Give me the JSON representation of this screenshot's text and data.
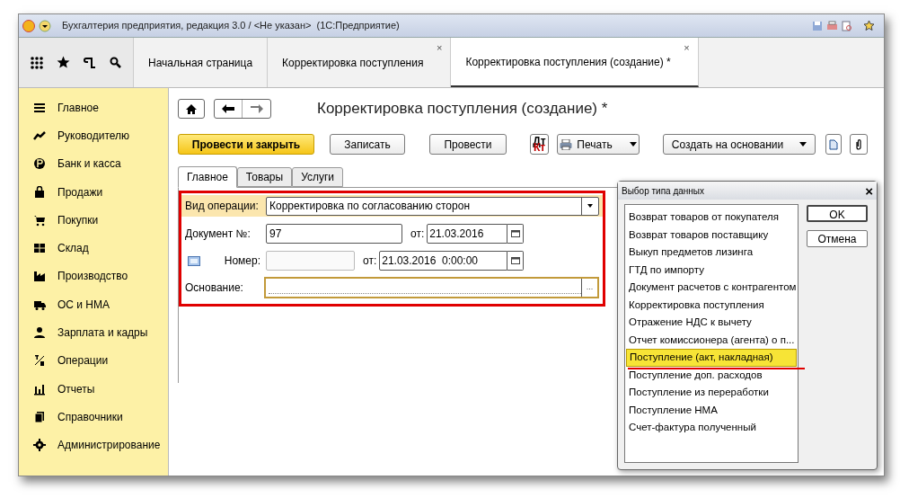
{
  "window": {
    "title": "Бухгалтерия предприятия, редакция 3.0 / <Не указан>  (1С:Предприятие)"
  },
  "tabs": [
    {
      "label": "Начальная страница",
      "closable": false,
      "selected": false
    },
    {
      "label": "Корректировка поступления",
      "closable": true,
      "selected": false
    },
    {
      "label": "Корректировка поступления (создание) *",
      "closable": true,
      "selected": true
    }
  ],
  "close_mark": "×",
  "sidebar": {
    "items": [
      {
        "label": "Главное"
      },
      {
        "label": "Руководителю"
      },
      {
        "label": "Банк и касса"
      },
      {
        "label": "Продажи"
      },
      {
        "label": "Покупки"
      },
      {
        "label": "Склад"
      },
      {
        "label": "Производство"
      },
      {
        "label": "ОС и НМА"
      },
      {
        "label": "Зарплата и кадры"
      },
      {
        "label": "Операции"
      },
      {
        "label": "Отчеты"
      },
      {
        "label": "Справочники"
      },
      {
        "label": "Администрирование"
      }
    ]
  },
  "form": {
    "title": "Корректировка поступления (создание) *",
    "commands": [
      {
        "kind": "primary",
        "label": "Провести и закрыть"
      },
      {
        "kind": "plain",
        "label": "Записать"
      },
      {
        "kind": "plain",
        "label": "Провести"
      },
      {
        "kind": "dtkt",
        "label": "Дт Кт"
      },
      {
        "kind": "print",
        "label": "Печать"
      },
      {
        "kind": "menu",
        "label": "Создать на основании"
      },
      {
        "kind": "doc"
      },
      {
        "kind": "clip"
      }
    ],
    "tabs": [
      {
        "label": "Главное",
        "selected": true
      },
      {
        "label": "Товары",
        "selected": false
      },
      {
        "label": "Услуги",
        "selected": false
      }
    ],
    "operation": {
      "label": "Вид операции:",
      "value": "Корректировка по согласованию сторон"
    },
    "document": {
      "label": "Документ №:",
      "value": "97",
      "date_label": "от:",
      "date": "21.03.2016"
    },
    "number": {
      "label": "Номер:",
      "disabled": true,
      "date_label": "от:",
      "date": "21.03.2016  0:00:00"
    },
    "basis": {
      "label": "Основание:",
      "button": "..."
    }
  },
  "dialog": {
    "title": "Выбор типа данных",
    "close": "×",
    "items": [
      {
        "label": "Возврат товаров от покупателя",
        "selected": false
      },
      {
        "label": "Возврат товаров поставщику",
        "selected": false
      },
      {
        "label": "Выкуп предметов лизинга",
        "selected": false
      },
      {
        "label": "ГТД по импорту",
        "selected": false
      },
      {
        "label": "Документ расчетов с контрагентом",
        "selected": false
      },
      {
        "label": "Корректировка поступления",
        "selected": false
      },
      {
        "label": "Отражение НДС к вычету",
        "selected": false
      },
      {
        "label": "Отчет комиссионера (агента) о п...",
        "selected": false
      },
      {
        "label": "Поступление (акт, накладная)",
        "selected": true
      },
      {
        "label": "Поступление доп. расходов",
        "selected": false
      },
      {
        "label": "Поступление из переработки",
        "selected": false
      },
      {
        "label": "Поступление НМА",
        "selected": false
      },
      {
        "label": "Счет-фактура полученный",
        "selected": false
      }
    ],
    "ok": "OK",
    "cancel": "Отмена"
  }
}
